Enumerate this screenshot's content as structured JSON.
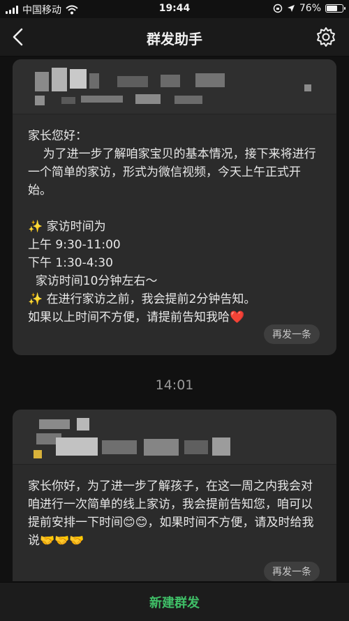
{
  "status_bar": {
    "carrier": "中国移动",
    "time": "19:44",
    "battery_percent": "76%",
    "battery_level": 0.76
  },
  "nav": {
    "title": "群发助手",
    "back_icon": "chevron-left-icon",
    "settings_icon": "gear-icon"
  },
  "messages": [
    {
      "text": "家长您好：\n    为了进一步了解咱家宝贝的基本情况，接下来将进行一个简单的家访，形式为微信视频，今天上午正式开始。\n\n✨ 家访时间为\n上午 9:30-11:00\n下午 1:30-4:30\n  家访时间10分钟左右～\n✨ 在进行家访之前，我会提前2分钟告知。\n如果以上时间不方便，请提前告知我哈❤️",
      "resend_label": "再发一条"
    },
    {
      "text": "家长你好，为了进一步了解孩子，在这一周之内我会对咱进行一次简单的线上家访，我会提前告知您，咱可以提前安排一下时间😊😊，如果时间不方便，请及时给我说🤝🤝🤝",
      "resend_label": "再发一条"
    }
  ],
  "time_separator": "14:01",
  "bottom": {
    "new_broadcast_label": "新建群发"
  },
  "colors": {
    "accent_green": "#3fbf67",
    "background": "#111111",
    "card": "#2b2b2b"
  }
}
